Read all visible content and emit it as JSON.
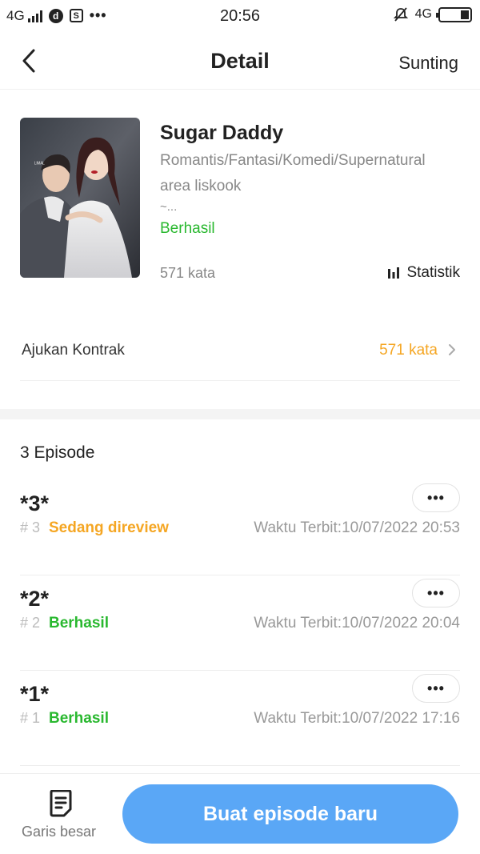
{
  "status_bar": {
    "network_left": "4G",
    "app_icon_1": "d",
    "app_icon_2": "S",
    "more": "•••",
    "time": "20:56",
    "network_right": "4G"
  },
  "nav": {
    "title": "Detail",
    "edit_label": "Sunting",
    "back_icon": "chevron-left-icon"
  },
  "book": {
    "title": "Sugar Daddy",
    "genres": "Romantis/Fantasi/Komedi/Supernatural",
    "description_line1": "area liskook",
    "description_line2": "~...",
    "status": "Berhasil",
    "word_count": "571 kata",
    "stats_label": "Statistik",
    "colors": {
      "status": "#29b82f"
    }
  },
  "contract": {
    "label": "Ajukan Kontrak",
    "value": "571 kata",
    "colors": {
      "value": "#f5a623"
    }
  },
  "episodes_header": "3 Episode",
  "episodes": [
    {
      "title": "*3*",
      "number": "# 3",
      "status": "Sedang direview",
      "status_type": "review",
      "published": "Waktu Terbit:10/07/2022 20:53",
      "more": "•••"
    },
    {
      "title": "*2*",
      "number": "# 2",
      "status": "Berhasil",
      "status_type": "ok",
      "published": "Waktu Terbit:10/07/2022 20:04",
      "more": "•••"
    },
    {
      "title": "*1*",
      "number": "# 1",
      "status": "Berhasil",
      "status_type": "ok",
      "published": "Waktu Terbit:10/07/2022 17:16",
      "more": "•••"
    }
  ],
  "bottom": {
    "outline_label": "Garis besar",
    "create_label": "Buat episode baru",
    "colors": {
      "create_button": "#5aa7f6"
    }
  }
}
